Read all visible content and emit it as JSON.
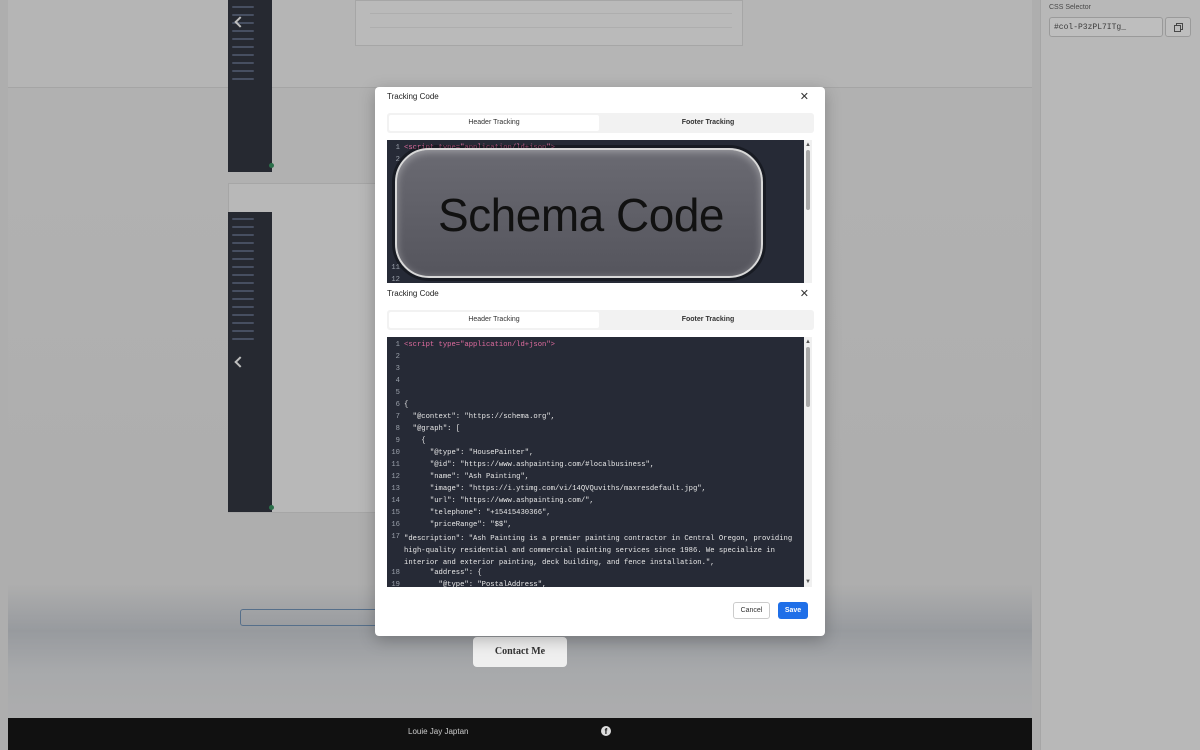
{
  "builder": {
    "css_selector_label": "CSS Selector",
    "css_selector_value": "#col-P3zPL7ITg_",
    "contact_button": "Contact Me",
    "footer_name": "Louie Jay Japtan",
    "footer_icon": "facebook-icon"
  },
  "modal_back": {
    "title": "Tracking Code",
    "tabs": [
      "Header Tracking",
      "Footer Tracking"
    ],
    "active_tab": "Header Tracking",
    "first_code_line": "<script type=\"application/ld+json\">",
    "overlay_text": "Schema Code"
  },
  "modal": {
    "title": "Tracking Code",
    "tabs": [
      "Header Tracking",
      "Footer Tracking"
    ],
    "active_tab": "Header Tracking",
    "cancel_label": "Cancel",
    "save_label": "Save",
    "code_lines": [
      {
        "n": "1",
        "text": "<script type=\"application/ld+json\">"
      },
      {
        "n": "2",
        "text": ""
      },
      {
        "n": "3",
        "text": ""
      },
      {
        "n": "4",
        "text": ""
      },
      {
        "n": "5",
        "text": ""
      },
      {
        "n": "6",
        "text": "{"
      },
      {
        "n": "7",
        "text": "  \"@context\": \"https://schema.org\","
      },
      {
        "n": "8",
        "text": "  \"@graph\": ["
      },
      {
        "n": "9",
        "text": "    {"
      },
      {
        "n": "10",
        "text": "      \"@type\": \"HousePainter\","
      },
      {
        "n": "11",
        "text": "      \"@id\": \"https://www.ashpainting.com/#localbusiness\","
      },
      {
        "n": "12",
        "text": "      \"name\": \"Ash Painting\","
      },
      {
        "n": "13",
        "text": "      \"image\": \"https://i.ytimg.com/vi/14QVQuviths/maxresdefault.jpg\","
      },
      {
        "n": "14",
        "text": "      \"url\": \"https://www.ashpainting.com/\","
      },
      {
        "n": "15",
        "text": "      \"telephone\": \"+15415430366\","
      },
      {
        "n": "16",
        "text": "      \"priceRange\": \"$$\","
      },
      {
        "n": "17",
        "text": "      \"description\": \"Ash Painting is a premier painting contractor in Central Oregon, providing high-quality residential and commercial painting services since 1986. We specialize in interior and exterior painting, deck building, and fence installation.\","
      },
      {
        "n": "18",
        "text": "      \"address\": {"
      },
      {
        "n": "19",
        "text": "        \"@type\": \"PostalAddress\","
      }
    ]
  },
  "colors": {
    "editor_bg": "#262a36",
    "save_button": "#1f6fe8",
    "tag_color": "#e06c9f",
    "attr_color": "#b0d06c"
  }
}
